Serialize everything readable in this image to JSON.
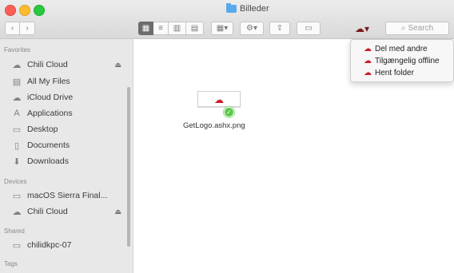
{
  "window": {
    "title": "Billeder"
  },
  "toolbar": {
    "back_glyph": "‹",
    "forward_glyph": "›",
    "view_icon_glyph": "▦",
    "view_list_glyph": "≡",
    "view_columns_glyph": "▥",
    "view_gallery_glyph": "▤",
    "group_glyph": "▦▾",
    "action_glyph": "⚙▾",
    "share_glyph": "⇪",
    "tags_glyph": "▭",
    "cloud_glyph": "☁▾",
    "search_placeholder": "Search"
  },
  "sidebar": {
    "sections": [
      {
        "label": "Favorites"
      },
      {
        "label": "Devices"
      },
      {
        "label": "Shared"
      },
      {
        "label": "Tags"
      }
    ],
    "favorites": [
      {
        "label": "Chili Cloud",
        "icon": "cloud-icon",
        "glyph": "☁",
        "eject": "⏏"
      },
      {
        "label": "All My Files",
        "icon": "all-files-icon",
        "glyph": "▤"
      },
      {
        "label": "iCloud Drive",
        "icon": "icloud-icon",
        "glyph": "☁"
      },
      {
        "label": "Applications",
        "icon": "applications-icon",
        "glyph": "A"
      },
      {
        "label": "Desktop",
        "icon": "desktop-icon",
        "glyph": "▭"
      },
      {
        "label": "Documents",
        "icon": "documents-icon",
        "glyph": "▯"
      },
      {
        "label": "Downloads",
        "icon": "downloads-icon",
        "glyph": "⬇"
      }
    ],
    "devices": [
      {
        "label": "macOS Sierra Final...",
        "icon": "disk-icon",
        "glyph": "▭"
      },
      {
        "label": "Chili Cloud",
        "icon": "cloud-icon",
        "glyph": "☁",
        "eject": "⏏"
      }
    ],
    "shared": [
      {
        "label": "chilidkpc-07",
        "icon": "computer-icon",
        "glyph": "▭"
      }
    ]
  },
  "content": {
    "file": {
      "name": "GetLogo.ashx.png",
      "badge_glyph": "✓",
      "cloud_glyph": "☁"
    }
  },
  "menu": {
    "items": [
      {
        "label": "Del med andre",
        "glyph": "☁"
      },
      {
        "label": "Tilgængelig offline",
        "glyph": "☁"
      },
      {
        "label": "Hent folder",
        "glyph": "☁"
      }
    ]
  },
  "colors": {
    "accent_red": "#c8202c",
    "badge_green": "#5cc64b",
    "folder_blue": "#5aa9ea"
  }
}
